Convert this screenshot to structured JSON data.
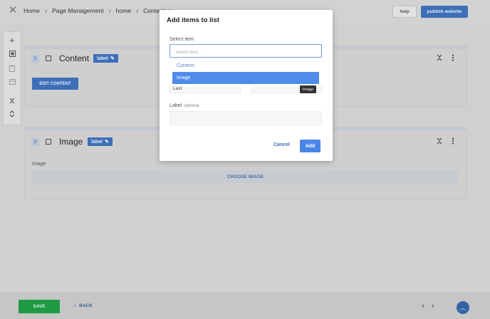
{
  "topbar": {
    "breadcrumbs": [
      "Home",
      "Page Management",
      "home",
      "Content w..."
    ],
    "help_label": "help",
    "publish_label": "publish website"
  },
  "toolbar": {
    "icons": [
      "plus-icon",
      "select-icon",
      "clipboard-icon",
      "layout-icon",
      "collapse-icon",
      "expand-icon"
    ]
  },
  "cards": [
    {
      "number": "2",
      "title": "Content",
      "label_badge": "label",
      "button": "EDIT CONTENT"
    },
    {
      "number": "3",
      "title": "Image",
      "label_badge": "label",
      "field_label": "Image",
      "button": "CHOOSE IMAGE"
    }
  ],
  "modal": {
    "title": "Add items to list",
    "select_label": "Select item",
    "select_placeholder": "select item...",
    "options": [
      "Content",
      "Image"
    ],
    "selected_option": "Image",
    "tooltip": "Image",
    "partial_field_value": "Last",
    "label_field_label": "Label",
    "label_field_optional": "optional",
    "cancel_label": "Cancel",
    "add_label": "Add"
  },
  "bottom": {
    "save_label": "SAVE",
    "back_label": "BACK"
  },
  "colors": {
    "accent": "#4a86e8",
    "save": "#1e9a42",
    "overlay": "#d0d0d0"
  }
}
